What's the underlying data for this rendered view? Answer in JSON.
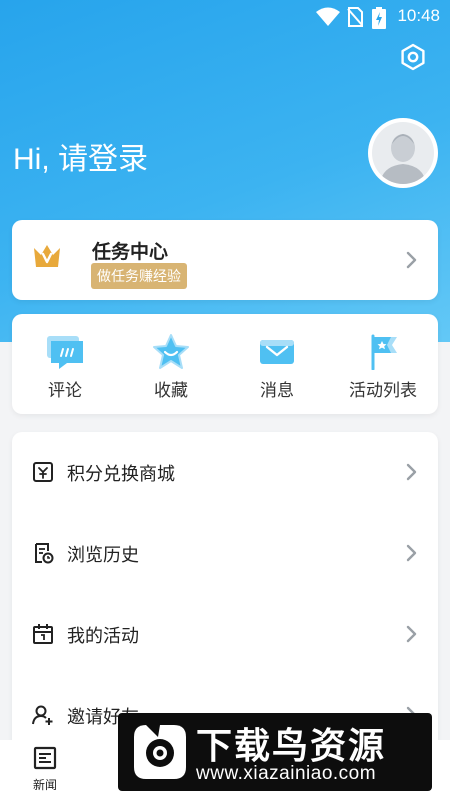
{
  "status_bar": {
    "time": "10:48",
    "icons": [
      "wifi-icon",
      "no-sim-icon",
      "battery-charging-icon"
    ]
  },
  "header": {
    "greeting": "Hi, 请登录",
    "settings_icon": "settings-icon",
    "avatar_icon": "default-avatar"
  },
  "task_center": {
    "title": "任务中心",
    "subtitle": "做任务赚经验",
    "icon": "crown-icon",
    "accent": "#d8b473"
  },
  "quick_actions": [
    {
      "label": "评论",
      "icon": "comment-icon"
    },
    {
      "label": "收藏",
      "icon": "star-icon"
    },
    {
      "label": "消息",
      "icon": "mail-icon"
    },
    {
      "label": "活动列表",
      "icon": "flag-icon"
    }
  ],
  "menu": [
    {
      "label": "积分兑换商城",
      "icon": "points-store-icon"
    },
    {
      "label": "浏览历史",
      "icon": "history-icon"
    },
    {
      "label": "我的活动",
      "icon": "calendar-icon"
    },
    {
      "label": "邀请好友",
      "icon": "invite-friend-icon"
    }
  ],
  "tabbar": {
    "news_label": "新闻"
  },
  "watermark": {
    "title": "下载鸟资源",
    "url": "www.xiazainiao.com"
  },
  "colors": {
    "header_gradient_start": "#27a4ec",
    "header_gradient_end": "#63c8f6",
    "icon_blue": "#4fc0f2",
    "background": "#f3f4f6"
  }
}
